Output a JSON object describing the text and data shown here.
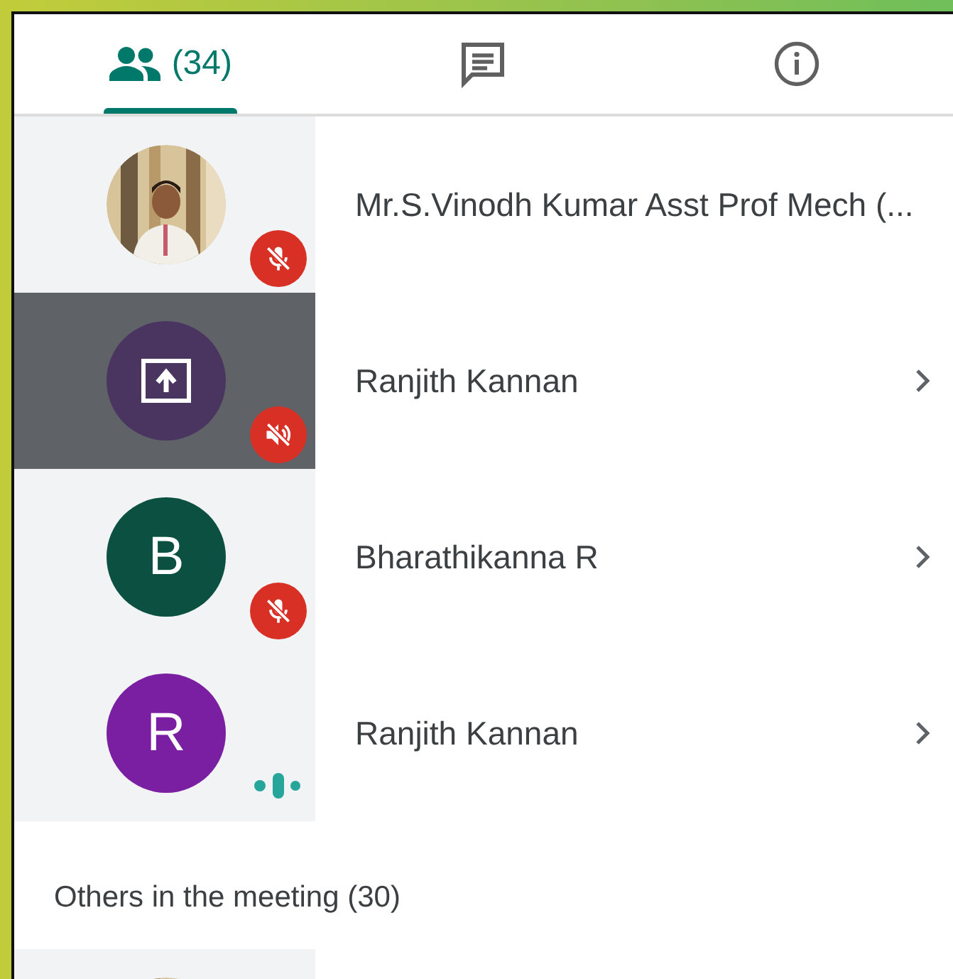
{
  "tabs": [
    {
      "kind": "people",
      "label": "(34)",
      "selected": true
    },
    {
      "kind": "chat",
      "selected": false
    },
    {
      "kind": "info",
      "selected": false
    }
  ],
  "participants": [
    {
      "name": "Mr.S.Vinodh Kumar Asst Prof Mech (...",
      "status": {
        "kind": "mic-off"
      },
      "selected": false,
      "chevron": false
    },
    {
      "name": "Ranjith Kannan",
      "avatar": {
        "kind": "presenting",
        "color": "#4a3561"
      },
      "status": {
        "kind": "sound-off"
      },
      "selected": true,
      "chevron": true
    },
    {
      "name": "Bharathikanna R",
      "avatar": {
        "kind": "letter",
        "initial": "B",
        "color": "#0b5040"
      },
      "status": {
        "kind": "mic-off"
      },
      "selected": false,
      "chevron": true
    },
    {
      "name": "Ranjith Kannan",
      "avatar": {
        "kind": "letter",
        "initial": "R",
        "color": "#7b1fa2"
      },
      "status": {
        "kind": "speaking"
      },
      "selected": false,
      "chevron": true
    }
  ],
  "others": {
    "heading": "Others in the meeting (30)"
  }
}
